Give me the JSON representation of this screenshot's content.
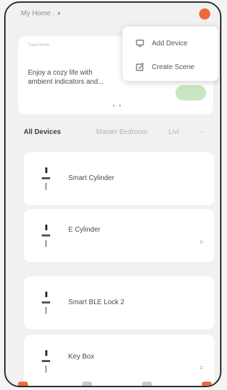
{
  "header": {
    "home_label": "My Home",
    "home_caret": "…▾",
    "plus_icon": "plus-circle-icon",
    "accent": "#ef6a3a"
  },
  "tip_card": {
    "small_label": "Tuya Home",
    "text": "Enjoy a cozy life with ambient indicators and...",
    "dots": "• •",
    "pill_color": "#c8e7c1"
  },
  "menu": {
    "items": [
      {
        "label": "Add Device",
        "icon": "add-device-icon"
      },
      {
        "label": "Create Scene",
        "icon": "create-scene-icon"
      }
    ]
  },
  "tabs": {
    "items": [
      {
        "label": "All Devices"
      },
      {
        "label": "Master Bedroom"
      },
      {
        "label": "Livi"
      }
    ],
    "more": "⋯"
  },
  "devices": [
    {
      "name": "Smart Cylinder",
      "action": ""
    },
    {
      "name": "E Cylinder",
      "action": "≡"
    },
    {
      "name": "Smart BLE Lock 2",
      "action": ""
    },
    {
      "name": "Key Box",
      "action": "≡"
    }
  ]
}
